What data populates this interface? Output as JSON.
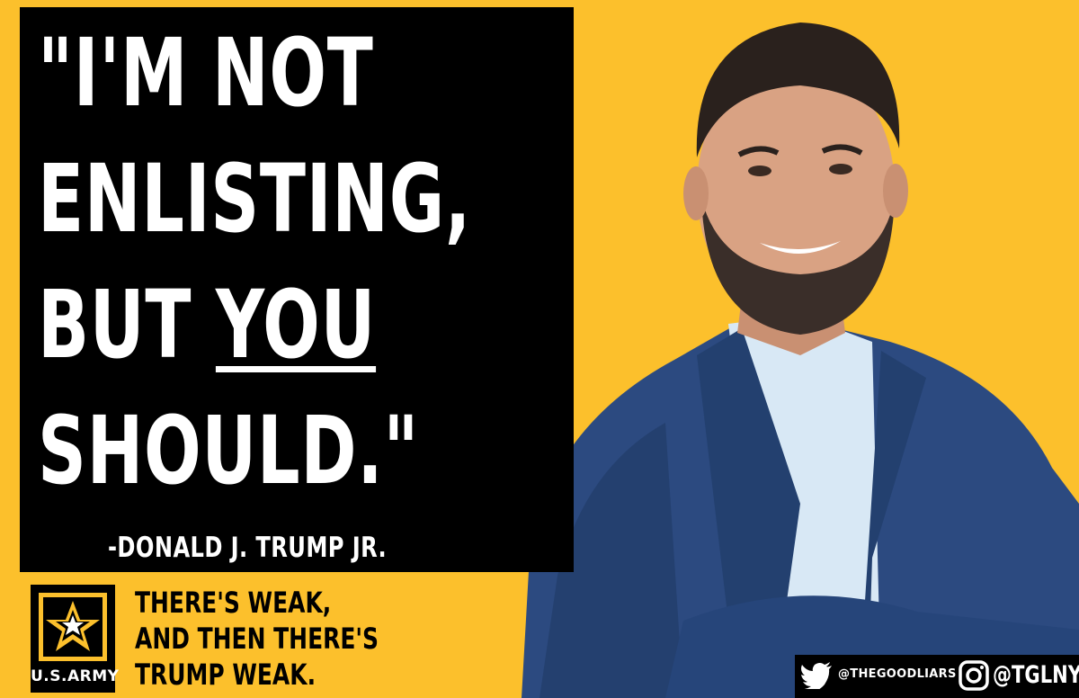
{
  "quote": {
    "line1": "\"I'M NOT",
    "line2": "ENLISTING,",
    "line3_before": "BUT ",
    "line3_emphasis": "YOU",
    "line4": "SHOULD.\"",
    "attribution": "-DONALD J. TRUMP JR."
  },
  "logo": {
    "icon": "army-star-icon",
    "text": "U.S.ARMY"
  },
  "tagline": {
    "line1": "THERE'S WEAK,",
    "line2": "AND THEN THERE'S",
    "line3": "TRUMP WEAK."
  },
  "social": {
    "twitter_icon": "twitter-bird-icon",
    "twitter_handle": "@THEGOODLIARS",
    "instagram_icon": "instagram-icon",
    "instagram_handle": "@TGLNYC"
  },
  "colors": {
    "background": "#fcc02c",
    "box": "#000000",
    "text_light": "#ffffff",
    "suit": "#2c4a80"
  }
}
